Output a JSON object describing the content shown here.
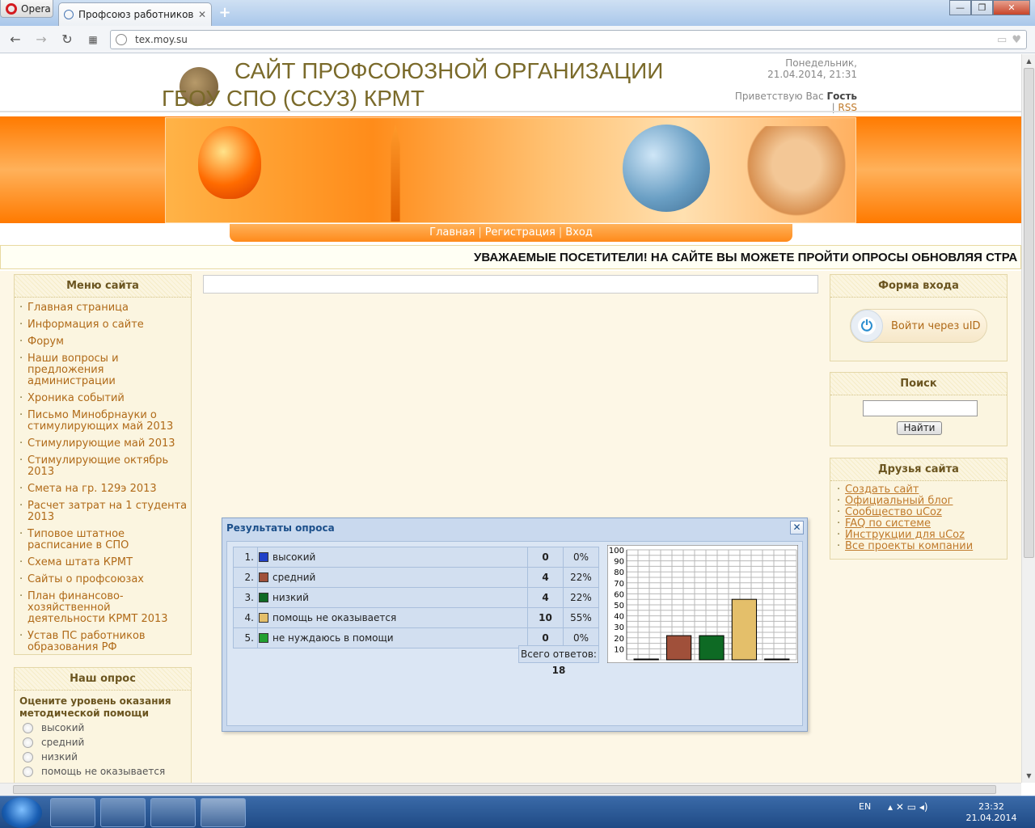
{
  "browser": {
    "app_button": "Opera",
    "tab_title": "Профсоюз работников о",
    "new_tab": "+",
    "address": "tex.moy.su"
  },
  "header": {
    "title": "САЙТ ПРОФСОЮЗНОЙ ОРГАНИЗАЦИИ ГБОУ СПО (ССУЗ) КРМТ",
    "date_line1": "Понедельник,",
    "date_line2": "21.04.2014, 21:31",
    "greeting": "Приветствую Вас",
    "user": "Гость",
    "rss": "RSS"
  },
  "nav": {
    "home": "Главная",
    "register": "Регистрация",
    "login": "Вход"
  },
  "marquee": "УВАЖАЕМЫЕ ПОСЕТИТЕЛИ! НА САЙТЕ ВЫ МОЖЕТЕ ПРОЙТИ ОПРОСЫ ОБНОВЛЯЯ СТРА",
  "menu": {
    "title": "Меню сайта",
    "items": [
      "Главная страница",
      "Информация о сайте",
      "Форум",
      "Наши вопросы и предложения администрации",
      "Хроника событий",
      "Письмо Минобрнауки о стимулирующих май 2013",
      "Стимулирующие май 2013",
      "Стимулирующие октябрь 2013",
      "Смета на гр. 129э 2013",
      "Расчет затрат на 1 студента 2013",
      "Типовое штатное расписание в СПО",
      "Схема штата КРМТ",
      "Сайты о профсоюзах",
      "План финансово-хозяйственной деятельности КРМТ 2013",
      "Устав ПС работников образования РФ"
    ]
  },
  "poll_widget": {
    "title": "Наш опрос",
    "question": "Оцените уровень оказания методической помощи",
    "options": [
      "высокий",
      "средний",
      "низкий",
      "помощь не оказывается"
    ]
  },
  "login_form": {
    "title": "Форма входа",
    "uid_button": "Войти через uID"
  },
  "search": {
    "title": "Поиск",
    "button": "Найти"
  },
  "friends": {
    "title": "Друзья сайта",
    "items": [
      "Создать сайт",
      "Официальный блог",
      "Сообщество uCoz",
      "FAQ по системе",
      "Инструкции для uCoz",
      "Все проекты компании"
    ]
  },
  "poll_results": {
    "title": "Результаты опроса",
    "close": "✕",
    "total_label": "Всего ответов:",
    "total": "18",
    "rows": [
      {
        "n": "1.",
        "label": "высокий",
        "color": "#2040c8",
        "count": "0",
        "pct": "0%"
      },
      {
        "n": "2.",
        "label": "средний",
        "color": "#a0503a",
        "count": "4",
        "pct": "22%"
      },
      {
        "n": "3.",
        "label": "низкий",
        "color": "#0e6a24",
        "count": "4",
        "pct": "22%"
      },
      {
        "n": "4.",
        "label": "помощь не оказывается",
        "color": "#e4bf6a",
        "count": "10",
        "pct": "55%"
      },
      {
        "n": "5.",
        "label": "не нуждаюсь в помощи",
        "color": "#22a030",
        "count": "0",
        "pct": "0%"
      }
    ]
  },
  "chart_data": {
    "type": "bar",
    "categories": [
      "высокий",
      "средний",
      "низкий",
      "помощь не оказывается",
      "не нуждаюсь в помощи"
    ],
    "values": [
      0,
      22,
      22,
      55,
      0
    ],
    "colors": [
      "#2040c8",
      "#a0503a",
      "#0e6a24",
      "#e4bf6a",
      "#22a030"
    ],
    "ylim": [
      0,
      100
    ],
    "yticks": [
      "100",
      "90",
      "80",
      "70",
      "60",
      "50",
      "40",
      "30",
      "20",
      "10"
    ],
    "grid": true
  },
  "taskbar": {
    "lang": "EN",
    "time": "23:32",
    "date": "21.04.2014"
  }
}
